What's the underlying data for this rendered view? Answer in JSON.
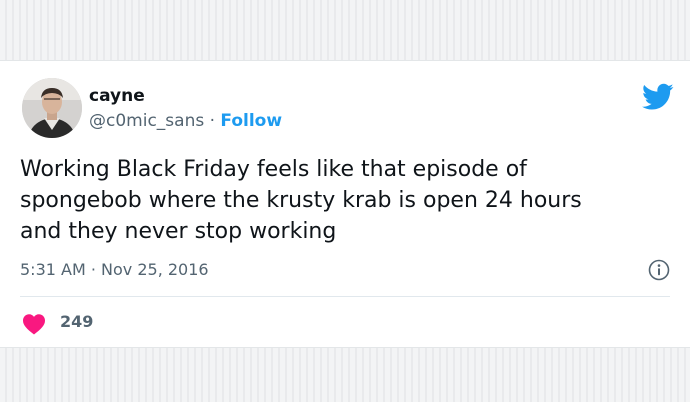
{
  "tweet": {
    "author_name": "cayne",
    "handle": "@c0mic_sans",
    "separator": "·",
    "follow_label": "Follow",
    "text_lines": [
      "Working Black Friday feels like that episode of",
      "spongebob where the krusty krab is open 24 hours",
      "and they never stop working"
    ],
    "timestamp": "5:31 AM · Nov 25, 2016",
    "like_count": "249"
  },
  "icons": {
    "brand": "twitter-bird-icon",
    "info": "info-icon",
    "like": "heart-icon"
  },
  "colors": {
    "accent": "#1d9bf0",
    "heart": "#f91880",
    "text": "#0f1419",
    "muted": "#536471"
  }
}
